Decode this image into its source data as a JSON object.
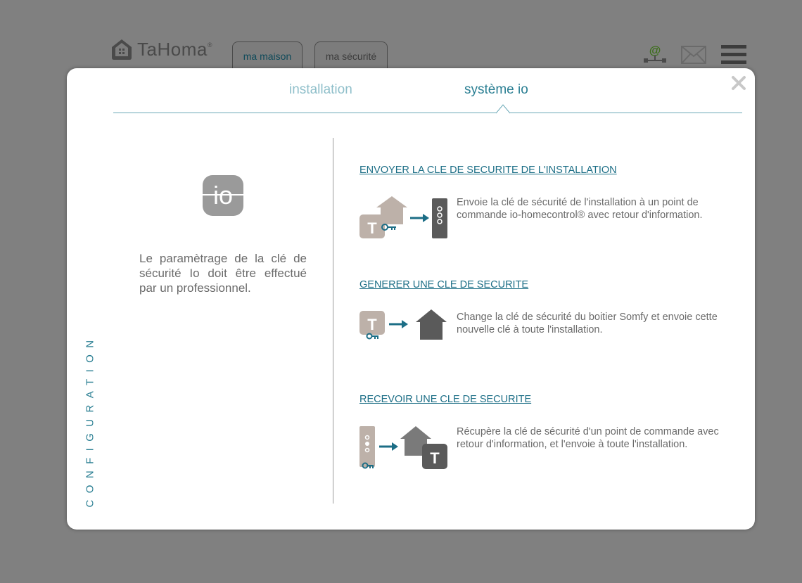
{
  "app": {
    "logo_text": "TaHoma",
    "logo_mark": "®"
  },
  "header": {
    "tabs": [
      {
        "label": "ma maison"
      },
      {
        "label": "ma sécurité"
      }
    ],
    "icons": [
      "at-network-icon",
      "mail-icon",
      "menu-icon"
    ]
  },
  "modal": {
    "tabs": [
      {
        "label": "installation",
        "active": false
      },
      {
        "label": "système io",
        "active": true
      }
    ],
    "side_label": "CONFIGURATION",
    "io_logo": "io",
    "left_text": "Le paramètrage de la clé de sécurité Io doit être effectué par un professionnel.",
    "sections": [
      {
        "title": "ENVOYER LA CLE DE SECURITE DE L'INSTALLATION",
        "description": "Envoie la clé de sécurité de l'installation à un point de commande io-homecontrol® avec retour d'information."
      },
      {
        "title": "GENERER UNE CLE DE SECURITE",
        "description": "Change la clé de sécurité du boitier Somfy et envoie cette nouvelle clé à toute l'installation."
      },
      {
        "title": "RECEVOIR UNE CLE DE SECURITE",
        "description": "Récupère la clé de sécurité d'un point de commande avec retour d'information, et l'envoie à toute l'installation."
      }
    ]
  },
  "colors": {
    "accent": "#2b7f93",
    "link": "#1c6e86",
    "overlay": "#808080"
  }
}
